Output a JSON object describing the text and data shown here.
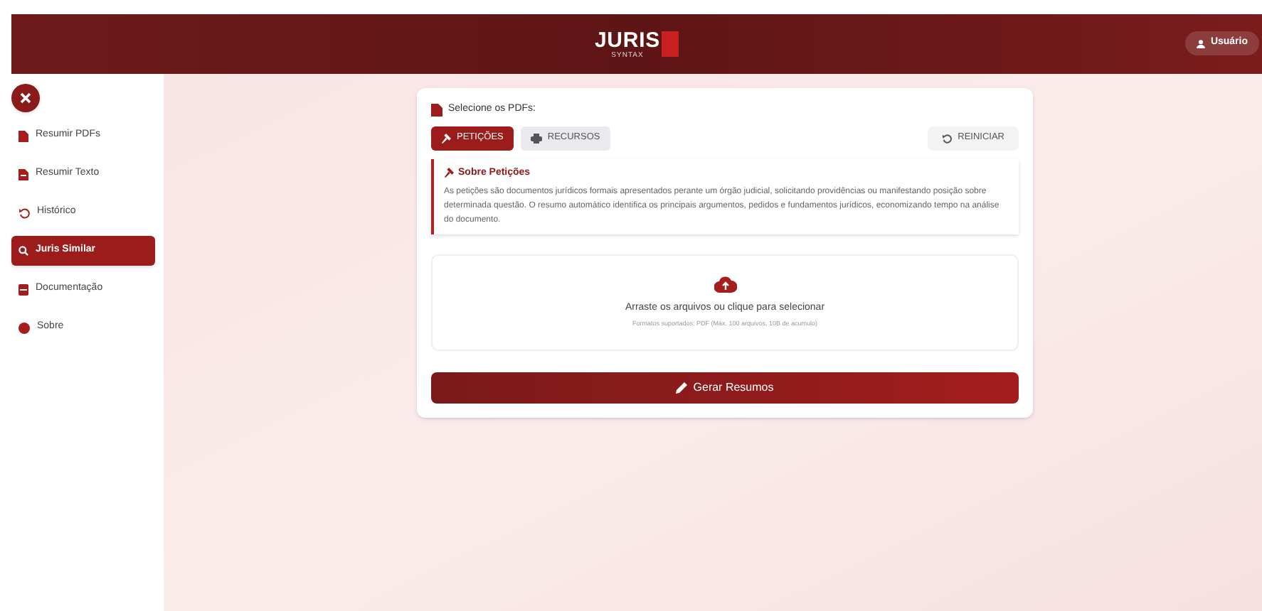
{
  "header": {
    "logo": "JURIS",
    "logo_sub": "SYNTAX",
    "user_button": "Usuário"
  },
  "sidebar": {
    "items": [
      {
        "label": "Resumir PDFs",
        "selected": false
      },
      {
        "label": "Resumir Texto",
        "selected": false
      },
      {
        "label": "Histórico",
        "selected": false
      },
      {
        "label": "Juris Similar",
        "selected": true
      },
      {
        "label": "Documentação",
        "selected": false
      },
      {
        "label": "Sobre",
        "selected": false
      }
    ]
  },
  "panel": {
    "heading": "Selecione os PDFs:",
    "tabs": [
      {
        "label": "PETIÇÕES",
        "selected": true
      },
      {
        "label": "RECURSOS",
        "selected": false
      }
    ],
    "reset_button": "REINICIAR",
    "info": {
      "title": "Sobre Petições",
      "text": "As petições são documentos jurídicos formais apresentados perante um órgão judicial, solicitando providências ou manifestando posição sobre determinada questão. O resumo automático identifica os principais argumentos, pedidos e fundamentos jurídicos, economizando tempo na análise do documento."
    },
    "dropzone": {
      "title": "Arraste os arquivos ou clique para selecionar",
      "hint": "Formatos suportados: PDF (Máx. 100 arquivos, 10B de acumulo)"
    },
    "submit_button": "Gerar Resumos"
  }
}
